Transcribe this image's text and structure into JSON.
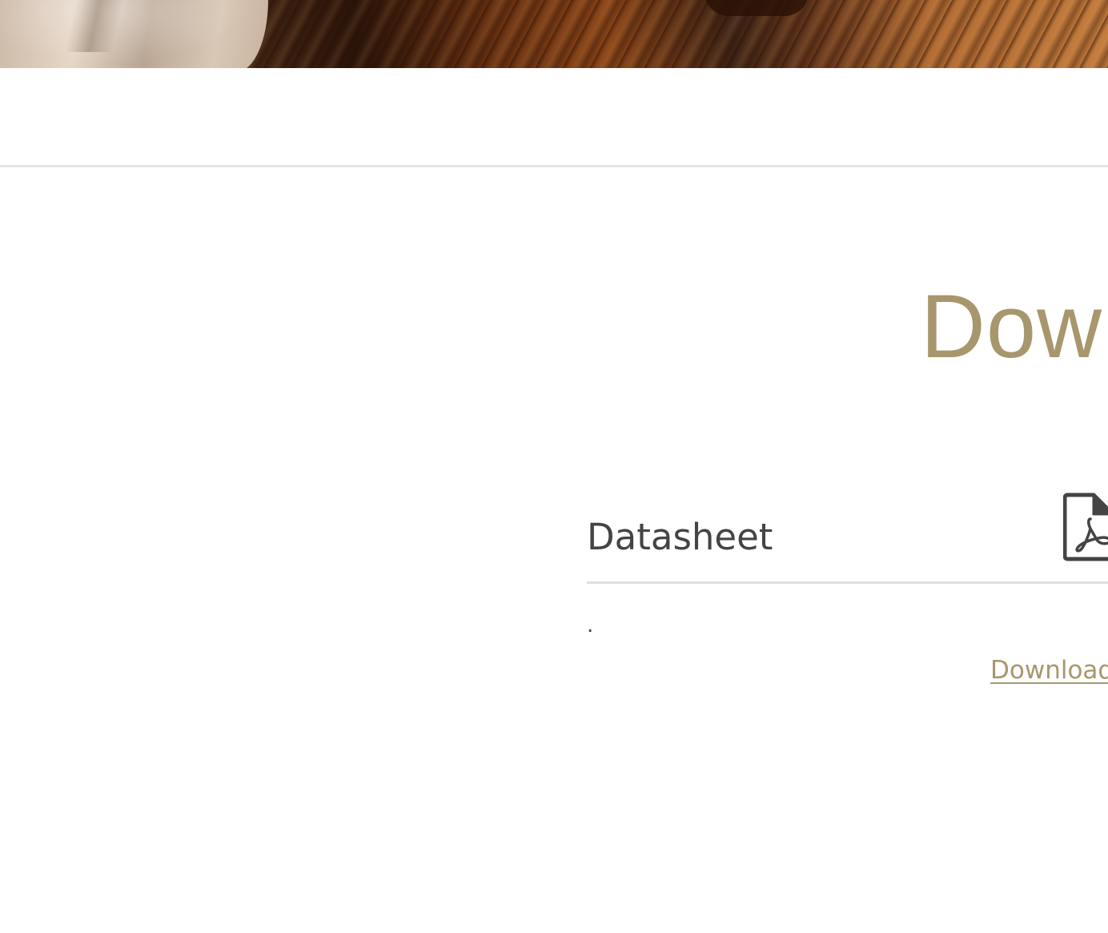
{
  "hero": {
    "image_alt": "",
    "icon": "wood-board-photo"
  },
  "section": {
    "heading": "Dow"
  },
  "downloads": [
    {
      "title": "Datasheet",
      "description": ".",
      "icon": "pdf-file-icon",
      "link_label": "Download"
    }
  ],
  "colors": {
    "accent": "#a8966c",
    "text": "#444444",
    "rule": "#e4e4e4"
  }
}
